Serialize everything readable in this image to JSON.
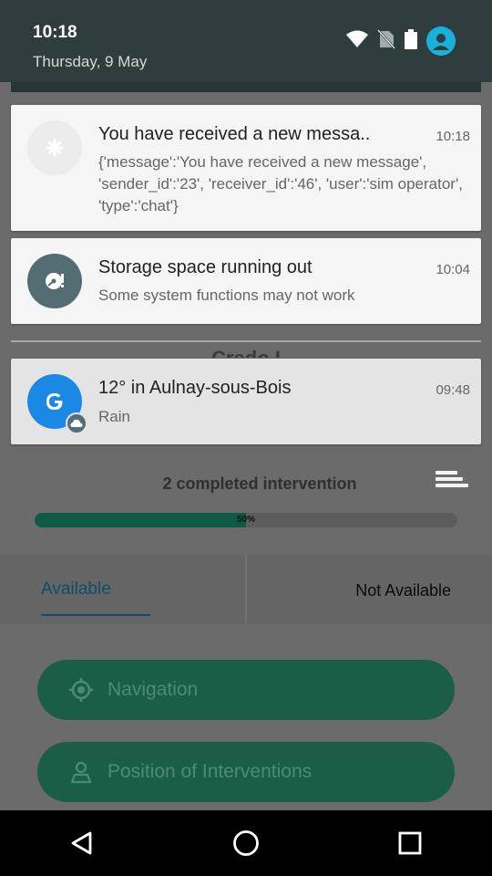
{
  "status": {
    "time": "10:18",
    "date": "Thursday, 9 May",
    "icons": [
      "wifi-icon",
      "no-sim-icon",
      "battery-icon",
      "account-icon"
    ]
  },
  "notifications": [
    {
      "title": "You have received a new messa..",
      "time": "10:18",
      "body": "{'message':'You have received a new message', 'sender_id':'23', 'receiver_id':'46', 'user':'sim operator', 'type':'chat'}",
      "icon": "app-icon"
    },
    {
      "title": "Storage space running out",
      "time": "10:04",
      "body": "Some system functions may not work",
      "icon": "storage-icon"
    },
    {
      "title": "12° in Aulnay-sous-Bois",
      "time": "09:48",
      "body": "Rain",
      "icon": "google-icon",
      "badge_icon": "cloud-icon"
    }
  ],
  "app": {
    "partial_heading": "Credo I",
    "completed": "2 completed intervention",
    "progress": {
      "value": 0.5,
      "label": "50%"
    },
    "tabs": {
      "available": "Available",
      "not_available": "Not Available"
    },
    "buttons": {
      "navigation": "Navigation",
      "position": "Position of Interventions"
    }
  },
  "colors": {
    "shade": "#2f3d3f",
    "accent": "#17b1d9",
    "google_blue": "#1c88e5",
    "app_green": "#1b5e48"
  }
}
